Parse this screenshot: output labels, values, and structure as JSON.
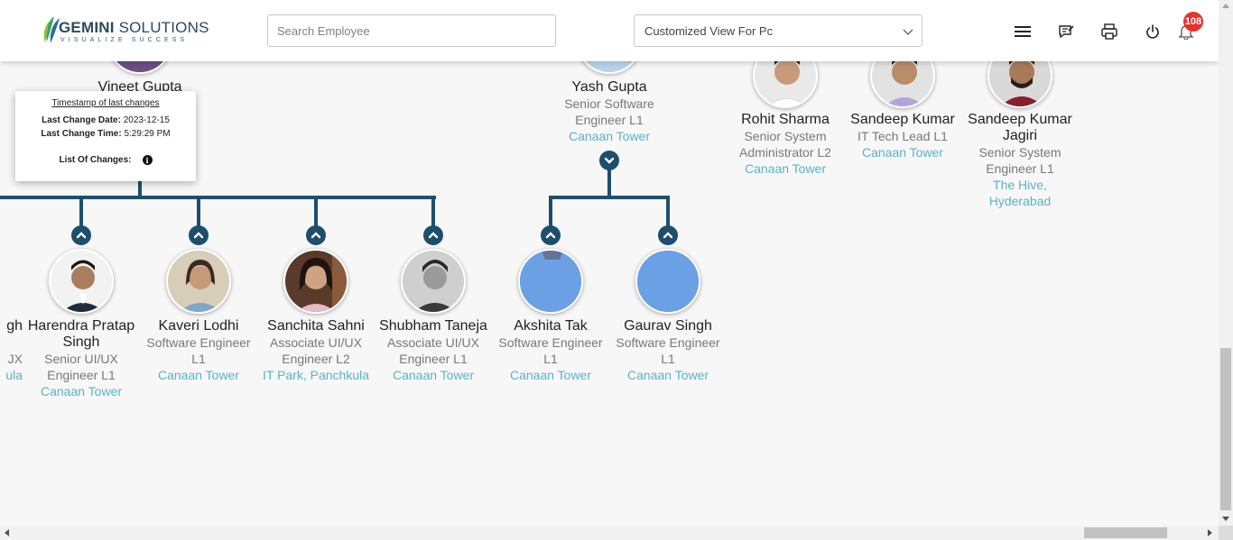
{
  "header": {
    "logo_name_bold": "GEMINI",
    "logo_name_rest": " SOLUTIONS",
    "logo_tagline": "VISUALIZE SUCCESS",
    "search_placeholder": "Search Employee",
    "view_select_value": "Customized View For Pc",
    "notification_count": "108",
    "icons": [
      "menu-icon",
      "feedback-icon",
      "print-icon",
      "power-icon",
      "bell-icon"
    ]
  },
  "tooltip": {
    "title": "Timestamp of last changes",
    "date_label": "Last Change Date:",
    "date_value": "2023-12-15",
    "time_label": "Last Change Time:",
    "time_value": "5:29:29 PM",
    "changes_label": "List Of Changes:"
  },
  "top_nodes": [
    {
      "name": "Vineet Gupta"
    },
    {
      "name": "Yash Gupta",
      "designation_1": "Senior Software",
      "designation_2": "Engineer L1",
      "location": "Canaan Tower"
    },
    {
      "name": "Rohit Sharma",
      "designation_1": "Senior System",
      "designation_2": "Administrator L2",
      "location": "Canaan Tower"
    },
    {
      "name": "Sandeep Kumar",
      "designation_1": "IT Tech Lead L1",
      "location": "Canaan Tower"
    },
    {
      "name_1": "Sandeep Kumar",
      "name_2": "Jagiri",
      "designation_1": "Senior System",
      "designation_2": "Engineer L1",
      "location_1": "The Hive,",
      "location_2": "Hyderabad"
    }
  ],
  "partial_node": {
    "name": "gh",
    "designation": "JX",
    "location": "ula"
  },
  "children": [
    {
      "name_1": "Harendra Pratap",
      "name_2": "Singh",
      "designation_1": "Senior UI/UX",
      "designation_2": "Engineer L1",
      "location": "Canaan Tower"
    },
    {
      "name": "Kaveri Lodhi",
      "designation_1": "Software Engineer",
      "designation_2": "L1",
      "location": "Canaan Tower"
    },
    {
      "name": "Sanchita Sahni",
      "designation_1": "Associate UI/UX",
      "designation_2": "Engineer L2",
      "location": "IT Park, Panchkula"
    },
    {
      "name": "Shubham Taneja",
      "designation_1": "Associate UI/UX",
      "designation_2": "Engineer L1",
      "location": "Canaan Tower"
    },
    {
      "name": "Akshita Tak",
      "designation_1": "Software Engineer",
      "designation_2": "L1",
      "location": "Canaan Tower"
    },
    {
      "name": "Gaurav Singh",
      "designation_1": "Software Engineer",
      "designation_2": "L1",
      "location": "Canaan Tower"
    }
  ],
  "colors": {
    "connector": "#1e4e6e",
    "location_text": "#5bb3c1",
    "placeholder_avatar": "#6ca0e4",
    "badge": "#e8312f"
  }
}
